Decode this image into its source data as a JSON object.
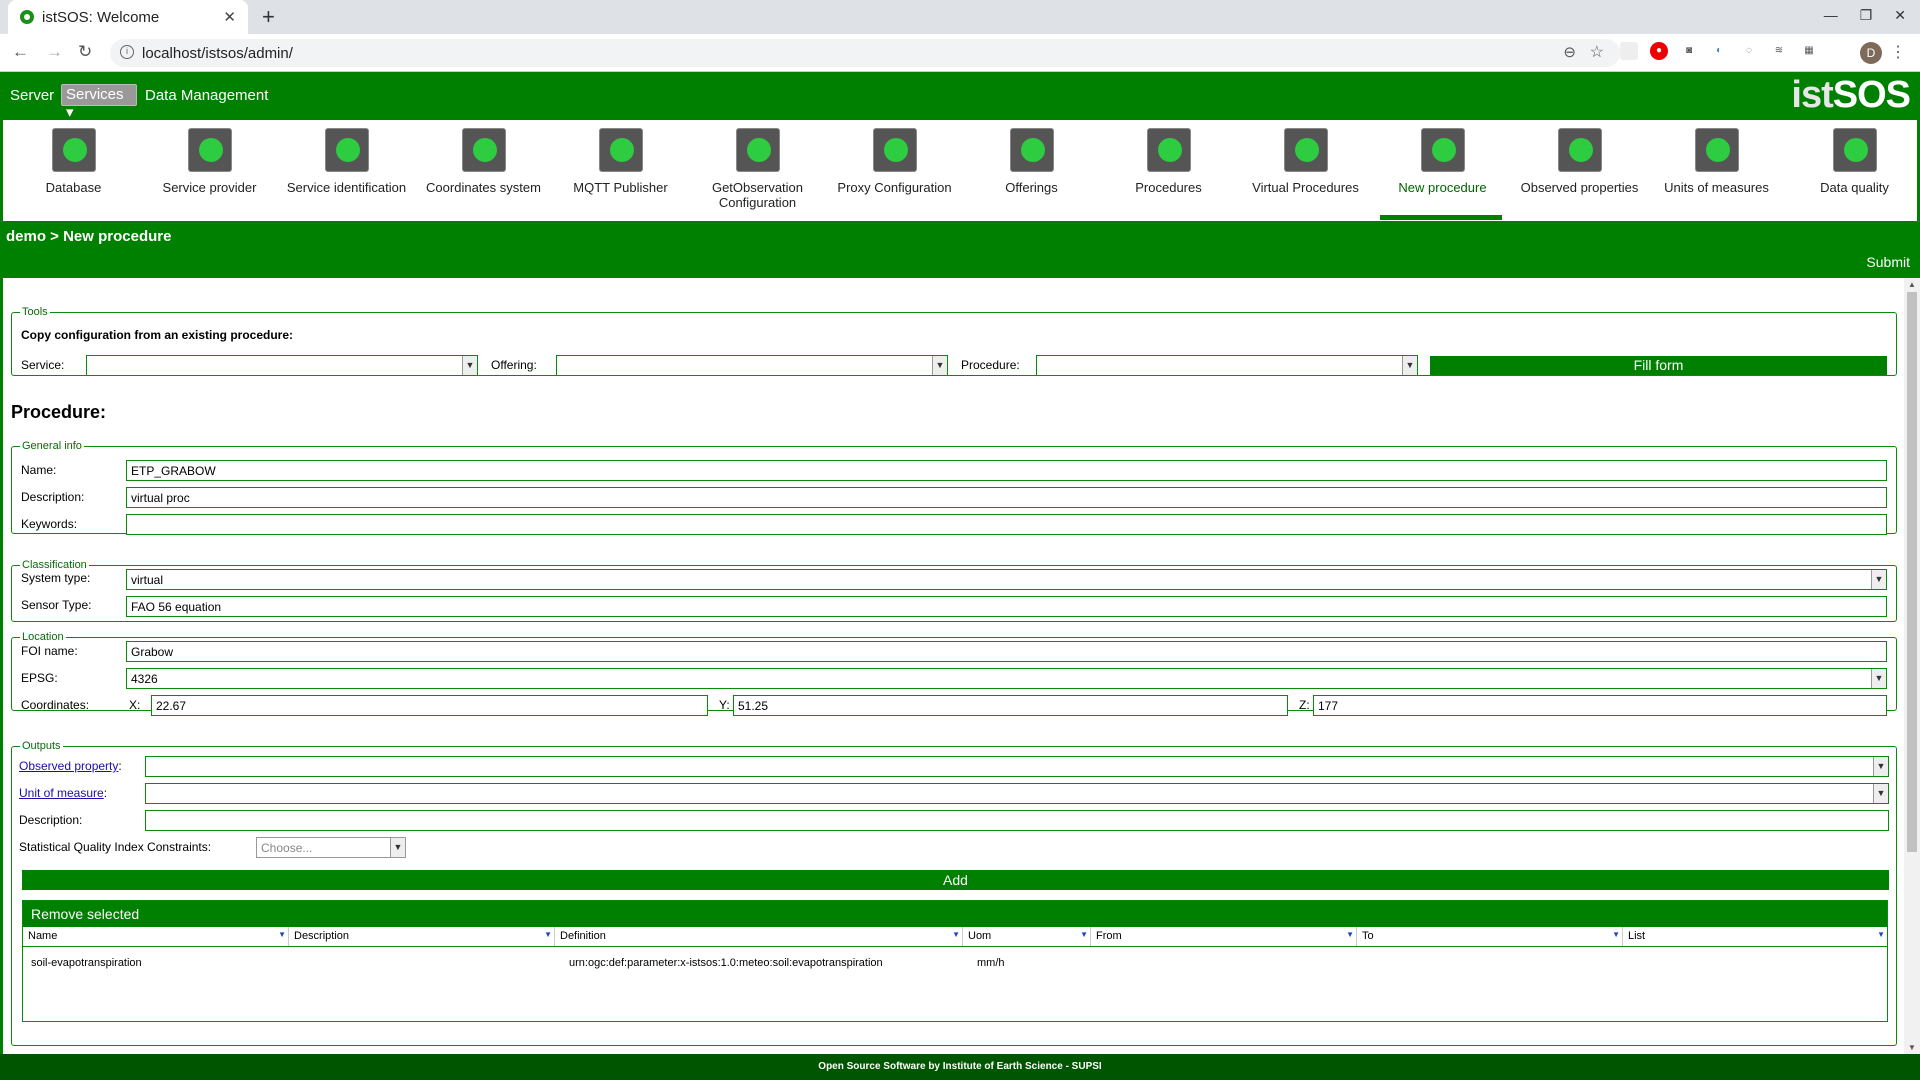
{
  "browser": {
    "tab_title": "istSOS: Welcome",
    "url": "localhost/istsos/admin/",
    "avatar_letter": "D"
  },
  "nav": {
    "server": "Server",
    "services": "Services ▾",
    "data_management": "Data Management",
    "logo_a": "ist",
    "logo_b": "SOS"
  },
  "toolbar": [
    {
      "label": "Database",
      "icon": "database-icon"
    },
    {
      "label": "Service provider",
      "icon": "service-provider-icon"
    },
    {
      "label": "Service identification",
      "icon": "service-identification-icon"
    },
    {
      "label": "Coordinates system",
      "icon": "globe-icon"
    },
    {
      "label": "MQTT Publisher",
      "icon": "mqtt-icon"
    },
    {
      "label": "GetObservation Configuration",
      "icon": "search-config-icon"
    },
    {
      "label": "Proxy Configuration",
      "icon": "proxy-icon"
    },
    {
      "label": "Offerings",
      "icon": "offerings-icon"
    },
    {
      "label": "Procedures",
      "icon": "gear-icon"
    },
    {
      "label": "Virtual Procedures",
      "icon": "ghost-icon"
    },
    {
      "label": "New procedure",
      "icon": "new-procedure-icon"
    },
    {
      "label": "Observed properties",
      "icon": "gauge-icon"
    },
    {
      "label": "Units of measures",
      "icon": "ruler-icon"
    },
    {
      "label": "Data quality",
      "icon": "quality-award-icon"
    }
  ],
  "breadcrumb": "demo > New procedure",
  "submit": "Submit",
  "tools": {
    "legend": "Tools",
    "heading": "Copy configuration from an existing procedure:",
    "service_label": "Service:",
    "offering_label": "Offering:",
    "procedure_label": "Procedure:",
    "fill_form": "Fill form"
  },
  "procedure_title": "Procedure:",
  "general": {
    "legend": "General info",
    "name_label": "Name:",
    "name": "ETP_GRABOW",
    "description_label": "Description:",
    "description": "virtual proc",
    "keywords_label": "Keywords:",
    "keywords": ""
  },
  "classification": {
    "legend": "Classification",
    "system_type_label": "System type:",
    "system_type": "virtual",
    "sensor_type_label": "Sensor Type:",
    "sensor_type": "FAO 56 equation"
  },
  "location": {
    "legend": "Location",
    "foi_label": "FOI name:",
    "foi": "Grabow",
    "epsg_label": "EPSG:",
    "epsg": "4326",
    "coords_label": "Coordinates:",
    "x_label": "X:",
    "x": "22.67",
    "y_label": "Y:",
    "y": "51.25",
    "z_label": "Z:",
    "z": "177"
  },
  "outputs": {
    "legend": "Outputs",
    "observed_property_label": "Observed property",
    "unit_label": "Unit of measure",
    "description_label": "Description:",
    "sqi_label": "Statistical Quality Index Constraints:",
    "sqi_placeholder": "Choose...",
    "add": "Add",
    "remove_selected": "Remove selected",
    "columns": [
      "Name",
      "Description",
      "Definition",
      "Uom",
      "From",
      "To",
      "List"
    ],
    "rows": [
      {
        "name": "soil-evapotranspiration",
        "description": "",
        "definition": "urn:ogc:def:parameter:x-istsos:1.0:meteo:soil:evapotranspiration",
        "uom": "mm/h",
        "from": "",
        "to": "",
        "list": ""
      }
    ]
  },
  "footer": "Open Source Software by Institute of Earth Science - SUPSI"
}
